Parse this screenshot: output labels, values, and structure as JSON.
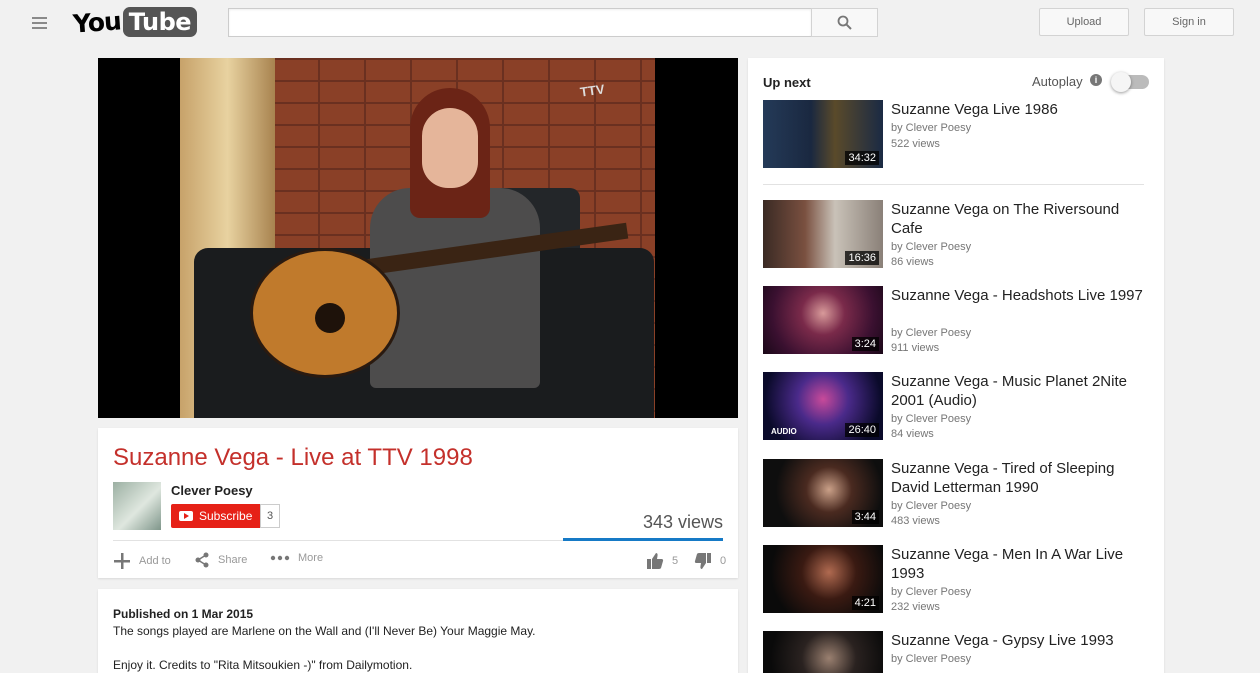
{
  "header": {
    "logo_you": "You",
    "logo_tube": "Tube",
    "search_placeholder": "",
    "upload_label": "Upload",
    "signin_label": "Sign in"
  },
  "video": {
    "watermark": "TTV",
    "title": "Suzanne Vega - Live at TTV 1998",
    "channel": "Clever Poesy",
    "subscribe_label": "Subscribe",
    "subscriber_count": "3",
    "views": "343 views",
    "actions": {
      "add_to": "Add to",
      "share": "Share",
      "more": "More",
      "likes": "5",
      "dislikes": "0"
    },
    "like_ratio": 1.0
  },
  "description": {
    "published": "Published on 1 Mar 2015",
    "line1": "The songs played are Marlene on the Wall and (I'll Never Be) Your Maggie May.",
    "line2": "Enjoy it. Credits to \"Rita Mitsoukien -)\" from Dailymotion."
  },
  "sidebar": {
    "up_next_label": "Up next",
    "autoplay_label": "Autoplay",
    "autoplay_on": false,
    "items": [
      {
        "title": "Suzanne Vega Live 1986",
        "by": "by Clever Poesy",
        "views": "522 views",
        "duration": "34:32"
      },
      {
        "title": "Suzanne Vega on The Riversound Cafe",
        "by": "by Clever Poesy",
        "views": "86 views",
        "duration": "16:36"
      },
      {
        "title": "Suzanne Vega - Headshots Live 1997",
        "by": "by Clever Poesy",
        "views": "911 views",
        "duration": "3:24"
      },
      {
        "title": "Suzanne Vega - Music Planet 2Nite 2001 (Audio)",
        "by": "by Clever Poesy",
        "views": "84 views",
        "duration": "26:40",
        "tag": "AUDIO"
      },
      {
        "title": "Suzanne Vega - Tired of Sleeping David Letterman 1990",
        "by": "by Clever Poesy",
        "views": "483 views",
        "duration": "3:44"
      },
      {
        "title": "Suzanne Vega - Men In A War Live 1993",
        "by": "by Clever Poesy",
        "views": "232 views",
        "duration": "4:21"
      },
      {
        "title": "Suzanne Vega - Gypsy Live 1993",
        "by": "by Clever Poesy",
        "views": "",
        "duration": ""
      }
    ]
  }
}
